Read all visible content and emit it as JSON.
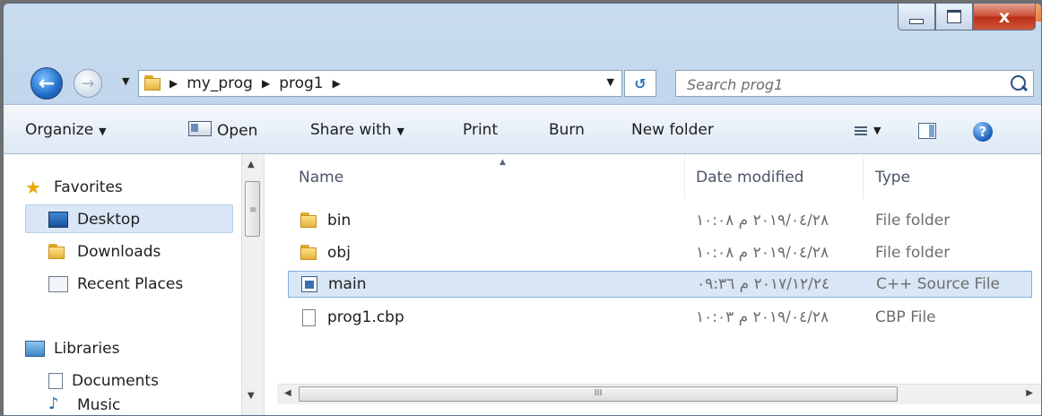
{
  "window": {
    "caption": {
      "close_label": "x"
    }
  },
  "nav": {
    "back_arrow": "←",
    "forward_arrow": "→",
    "recent_caret": "▼",
    "address": {
      "segments": [
        "my_prog",
        "prog1"
      ],
      "separator": "▶",
      "dropdown_caret": "▼"
    },
    "refresh_glyph": "↺",
    "search": {
      "placeholder": "Search prog1"
    }
  },
  "toolbar": {
    "organize": "Organize",
    "open": "Open",
    "share_with": "Share with",
    "print": "Print",
    "burn": "Burn",
    "new_folder": "New folder",
    "caret": "▼",
    "help": "?"
  },
  "navpane": {
    "favorites": "Favorites",
    "items": [
      {
        "label": "Desktop",
        "selected": true
      },
      {
        "label": "Downloads"
      },
      {
        "label": "Recent Places"
      }
    ],
    "libraries": "Libraries",
    "library_items": [
      {
        "label": "Documents"
      },
      {
        "label": "Music"
      }
    ]
  },
  "filelist": {
    "columns": {
      "name": "Name",
      "date": "Date modified",
      "type": "Type"
    },
    "rows": [
      {
        "name": "bin",
        "date": "٢٠١٩/٠٤/٢٨ م ١٠:٠٨",
        "type": "File folder",
        "icon": "folder-icon"
      },
      {
        "name": "obj",
        "date": "٢٠١٩/٠٤/٢٨ م ١٠:٠٨",
        "type": "File folder",
        "icon": "folder-icon"
      },
      {
        "name": "main",
        "date": "٢٠١٧/١٢/٢٤ م ٠٩:٣٦",
        "type": "C++ Source File",
        "icon": "cpp-file-icon",
        "selected": true
      },
      {
        "name": "prog1.cbp",
        "date": "٢٠١٩/٠٤/٢٨ م ١٠:٠٣",
        "type": "CBP File",
        "icon": "file-icon"
      }
    ],
    "hscroll_grip": "III"
  },
  "colors": {
    "accent": "#1f6cc7",
    "selection": "#d8e6f5",
    "close": "#c94b32"
  }
}
